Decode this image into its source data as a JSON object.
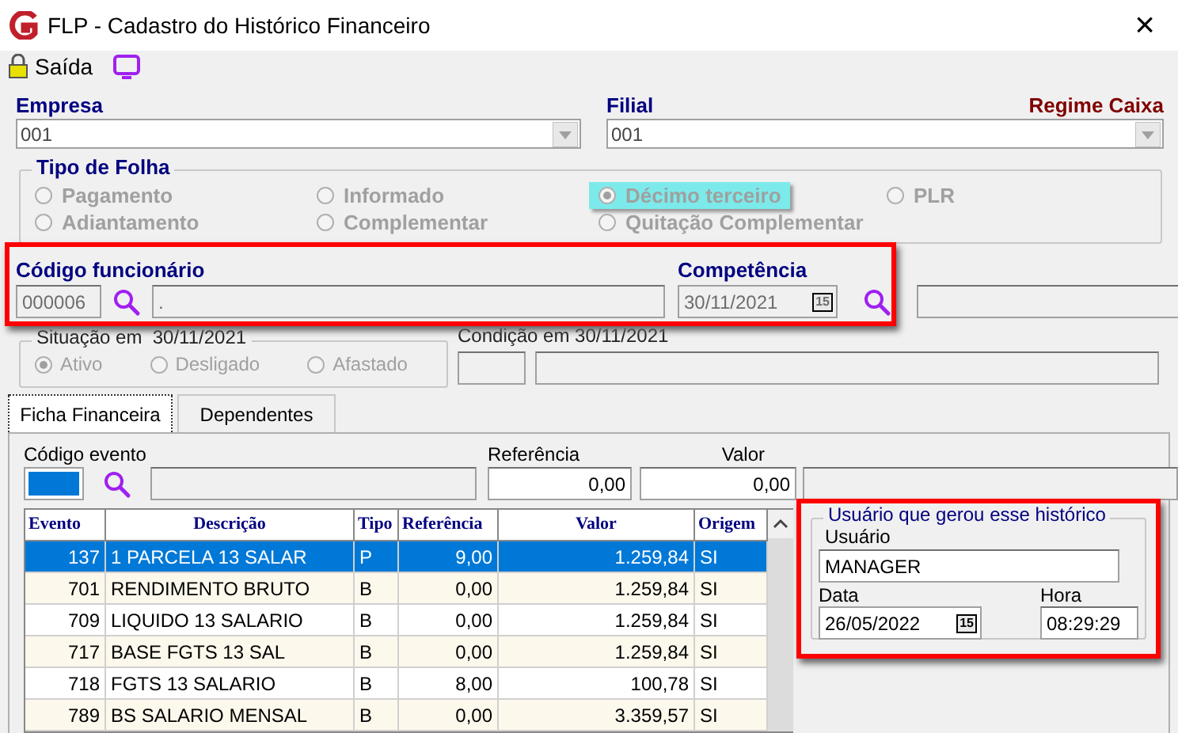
{
  "window": {
    "title": "FLP - Cadastro do Histórico Financeiro",
    "close": "×"
  },
  "toolbar": {
    "exit": "Saída"
  },
  "empresa": {
    "label": "Empresa",
    "value": "001"
  },
  "filial": {
    "label": "Filial",
    "value": "001"
  },
  "regime": "Regime Caixa",
  "tipo_folha": {
    "title": "Tipo de Folha",
    "options": [
      {
        "label": "Pagamento",
        "selected": false,
        "highlighted": false
      },
      {
        "label": "Informado",
        "selected": false,
        "highlighted": false
      },
      {
        "label": "Décimo terceiro",
        "selected": true,
        "highlighted": true
      },
      {
        "label": "PLR",
        "selected": false,
        "highlighted": false
      },
      {
        "label": "Adiantamento",
        "selected": false,
        "highlighted": false
      },
      {
        "label": "Complementar",
        "selected": false,
        "highlighted": false
      },
      {
        "label": "Quitação Complementar",
        "selected": false,
        "highlighted": false
      }
    ]
  },
  "funcionario": {
    "label": "Código funcionário",
    "code": "000006",
    "name": "."
  },
  "competencia": {
    "label": "Competência",
    "value": "30/11/2021",
    "calendar": "15"
  },
  "situacao": {
    "title": "Situação em  30/11/2021",
    "options": [
      {
        "label": "Ativo",
        "selected": true
      },
      {
        "label": "Desligado",
        "selected": false
      },
      {
        "label": "Afastado",
        "selected": false
      }
    ]
  },
  "condicao": {
    "label": "Condição em 30/11/2021"
  },
  "tabs": [
    {
      "label": "Ficha Financeira",
      "selected": true
    },
    {
      "label": "Dependentes",
      "selected": false
    }
  ],
  "evento": {
    "label": "Código evento",
    "ref_label": "Referência",
    "ref_value": "0,00",
    "valor_label": "Valor",
    "valor_value": "0,00"
  },
  "table": {
    "columns": [
      "Evento",
      "Descrição",
      "Tipo",
      "Referência",
      "Valor",
      "Origem"
    ],
    "rows": [
      {
        "cells": [
          "137",
          "1 PARCELA 13 SALAR",
          "P",
          "9,00",
          "1.259,84",
          "SI"
        ],
        "selected": true
      },
      {
        "cells": [
          "701",
          "RENDIMENTO BRUTO",
          "B",
          "0,00",
          "1.259,84",
          "SI"
        ],
        "selected": false
      },
      {
        "cells": [
          "709",
          "LIQUIDO 13 SALARIO",
          "B",
          "0,00",
          "1.259,84",
          "SI"
        ],
        "selected": false
      },
      {
        "cells": [
          "717",
          "BASE FGTS 13 SAL",
          "B",
          "0,00",
          "1.259,84",
          "SI"
        ],
        "selected": false
      },
      {
        "cells": [
          "718",
          "FGTS 13 SALARIO",
          "B",
          "8,00",
          "100,78",
          "SI"
        ],
        "selected": false
      },
      {
        "cells": [
          "789",
          "BS SALARIO MENSAL",
          "B",
          "0,00",
          "3.359,57",
          "SI"
        ],
        "selected": false
      }
    ]
  },
  "user_box": {
    "title": "Usuário que gerou esse histórico",
    "user_label": "Usuário",
    "user": "MANAGER",
    "date_label": "Data",
    "date": "26/05/2022",
    "calendar": "15",
    "time_label": "Hora",
    "time": "08:29:29"
  }
}
